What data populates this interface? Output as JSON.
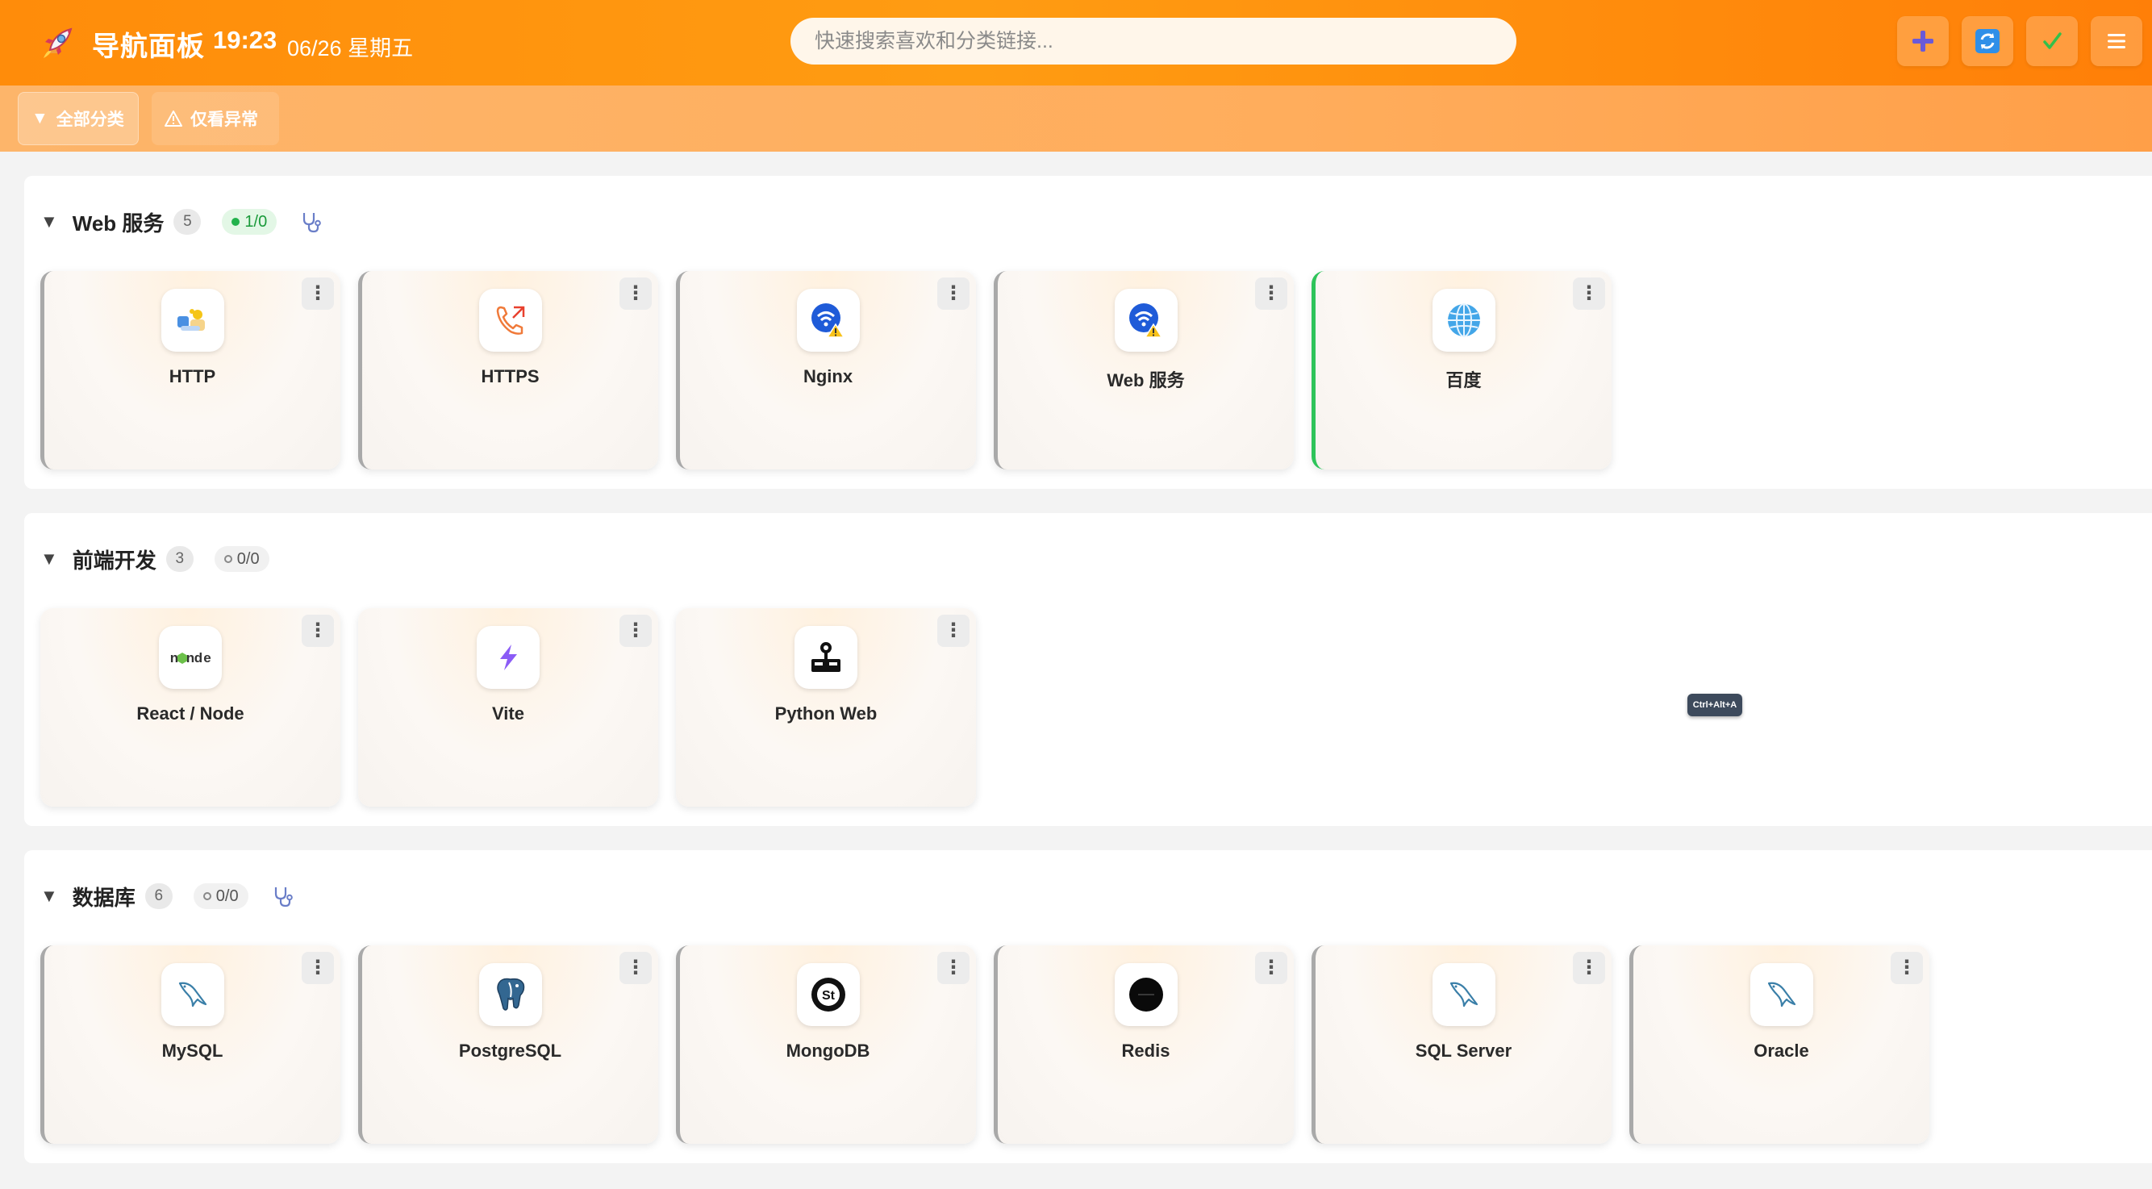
{
  "header": {
    "title": "导航面板",
    "time": "19:23",
    "date": "06/26 星期五",
    "search_placeholder": "快速搜索喜欢和分类链接...",
    "buttons": [
      "add-icon",
      "refresh-icon",
      "check-icon",
      "menu-icon"
    ]
  },
  "filters": {
    "all": "全部分类",
    "abnormal": "仅看异常"
  },
  "sections": [
    {
      "title": "Web 服务",
      "count": "5",
      "status": "1/0",
      "cards": [
        {
          "name": "HTTP",
          "icon": "http-icon"
        },
        {
          "name": "HTTPS",
          "icon": "https-phone-icon"
        },
        {
          "name": "Nginx",
          "icon": "wifi-warning-icon"
        },
        {
          "name": "Web 服务",
          "icon": "wifi-warning-icon"
        },
        {
          "name": "百度",
          "icon": "globe-icon"
        }
      ]
    },
    {
      "title": "前端开发",
      "count": "3",
      "status": "0/0",
      "cards": [
        {
          "name": "React / Node",
          "icon": "node-icon"
        },
        {
          "name": "Vite",
          "icon": "vite-icon"
        },
        {
          "name": "Python Web",
          "icon": "python-web-icon"
        }
      ]
    },
    {
      "title": "数据库",
      "count": "6",
      "status": "0/0",
      "cards": [
        {
          "name": "MySQL",
          "icon": "mysql-dolphin-icon"
        },
        {
          "name": "PostgreSQL",
          "icon": "postgres-elephant-icon"
        },
        {
          "name": "MongoDB",
          "icon": "st-logo-icon"
        },
        {
          "name": "Redis",
          "icon": "black-circle-icon"
        },
        {
          "name": "SQL Server",
          "icon": "mysql-dolphin-icon"
        },
        {
          "name": "Oracle",
          "icon": "mysql-dolphin-icon"
        }
      ]
    }
  ],
  "kbd_tip": "Ctrl+Alt+A",
  "colors": {
    "header": "#ff8c0a",
    "filterbar": "#fdb56a",
    "ok": "#22b24c",
    "card_edge": "#a9a9a9",
    "card_edge_ok": "#2ec45a"
  }
}
